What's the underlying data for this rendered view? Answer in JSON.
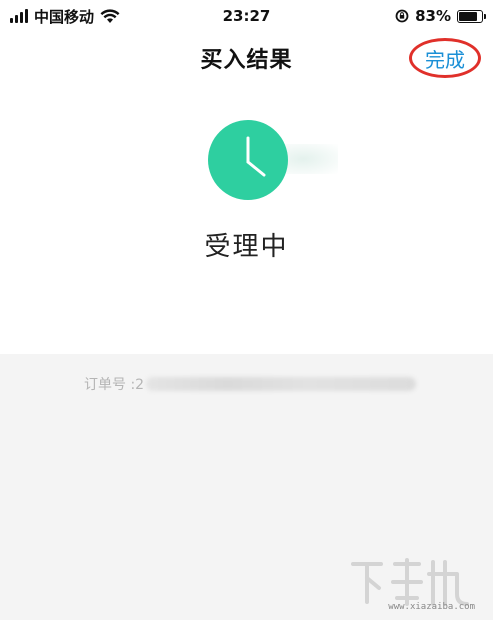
{
  "status_bar": {
    "carrier": "中国移动",
    "time": "23:27",
    "battery_percent": "83%",
    "battery_level": 0.83
  },
  "nav": {
    "title": "买入结果",
    "done_label": "完成"
  },
  "result": {
    "status_text": "受理中",
    "icon": "clock-icon",
    "accent_color": "#2ecfa0"
  },
  "detail": {
    "order_label": "订单号 :2"
  },
  "watermark": {
    "site": "www.xiazaiba.com"
  },
  "colors": {
    "done_text": "#1a8fd6",
    "done_circle": "#e0302a",
    "detail_bg": "#f4f4f4"
  }
}
